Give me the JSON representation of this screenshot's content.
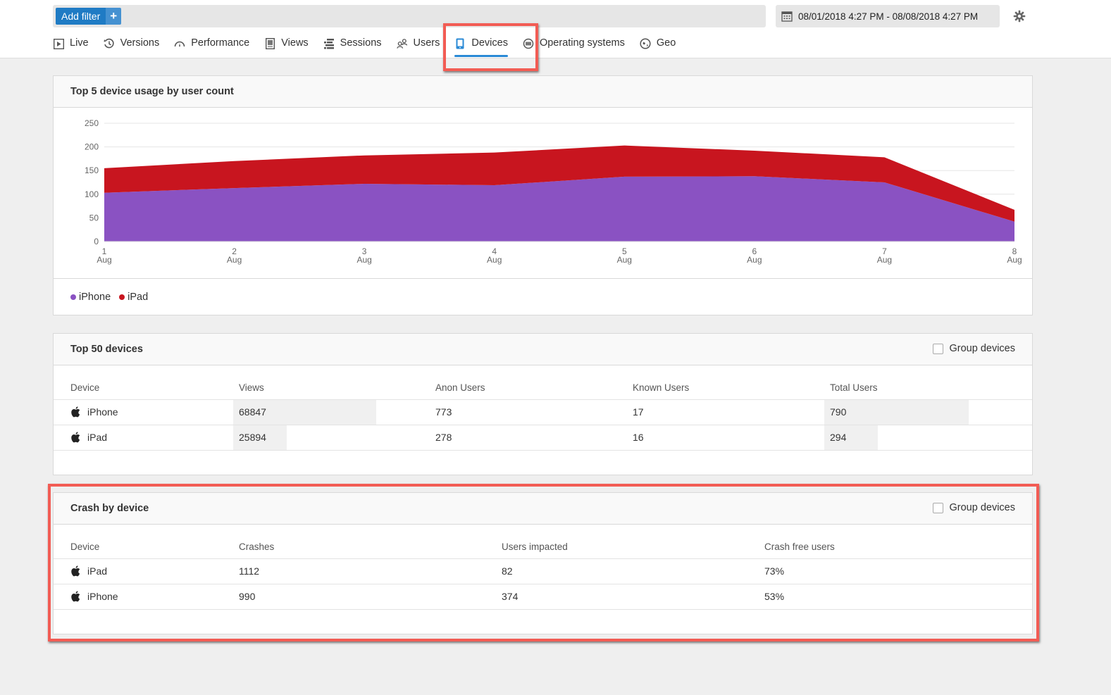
{
  "filter": {
    "add_label": "Add filter",
    "add_icon": "plus-icon"
  },
  "date_range": {
    "value": "08/01/2018 4:27 PM - 08/08/2018 4:27 PM",
    "icon": "calendar-icon"
  },
  "settings_icon": "gear-icon",
  "tabs": [
    {
      "label": "Live",
      "icon": "play-icon"
    },
    {
      "label": "Versions",
      "icon": "history-icon"
    },
    {
      "label": "Performance",
      "icon": "gauge-icon"
    },
    {
      "label": "Views",
      "icon": "document-icon"
    },
    {
      "label": "Sessions",
      "icon": "sessions-icon"
    },
    {
      "label": "Users",
      "icon": "users-icon"
    },
    {
      "label": "Devices",
      "icon": "mobile-device-icon",
      "active": true
    },
    {
      "label": "Operating systems",
      "icon": "os-icon"
    },
    {
      "label": "Geo",
      "icon": "globe-icon"
    }
  ],
  "usage_panel": {
    "title": "Top 5 device usage by user count"
  },
  "chart_data": {
    "type": "area",
    "stacked": true,
    "title": "Top 5 device usage by user count",
    "xlabel": "",
    "ylabel": "",
    "x": [
      "1\nAug",
      "2\nAug",
      "3\nAug",
      "4\nAug",
      "5\nAug",
      "6\nAug",
      "7\nAug",
      "8\nAug"
    ],
    "x_ticks": [
      {
        "day": "1",
        "month": "Aug"
      },
      {
        "day": "2",
        "month": "Aug"
      },
      {
        "day": "3",
        "month": "Aug"
      },
      {
        "day": "4",
        "month": "Aug"
      },
      {
        "day": "5",
        "month": "Aug"
      },
      {
        "day": "6",
        "month": "Aug"
      },
      {
        "day": "7",
        "month": "Aug"
      },
      {
        "day": "8",
        "month": "Aug"
      }
    ],
    "series": [
      {
        "name": "iPhone",
        "color": "#8a52c2",
        "values": [
          103,
          113,
          122,
          119,
          137,
          138,
          125,
          42
        ]
      },
      {
        "name": "iPad",
        "color": "#c8151f",
        "values": [
          52,
          57,
          60,
          69,
          66,
          54,
          53,
          25
        ]
      }
    ],
    "ylim": [
      0,
      250
    ],
    "y_ticks": [
      0,
      50,
      100,
      150,
      200,
      250
    ],
    "grid": true,
    "legend": "bottom-left"
  },
  "top_devices": {
    "title": "Top 50 devices",
    "group_label": "Group devices",
    "group_checked": false,
    "columns": [
      "Device",
      "Views",
      "Anon Users",
      "Known Users",
      "Total Users"
    ],
    "rows": [
      {
        "device": "iPhone",
        "icon": "apple-icon",
        "views": "68847",
        "views_share": 1.0,
        "anon": "773",
        "known": "17",
        "total": "790",
        "total_share": 1.0
      },
      {
        "device": "iPad",
        "icon": "apple-icon",
        "views": "25894",
        "views_share": 0.376,
        "anon": "278",
        "known": "16",
        "total": "294",
        "total_share": 0.372
      }
    ]
  },
  "crash_devices": {
    "title": "Crash by device",
    "group_label": "Group devices",
    "group_checked": false,
    "columns": [
      "Device",
      "Crashes",
      "Users impacted",
      "Crash free users"
    ],
    "rows": [
      {
        "device": "iPad",
        "icon": "apple-icon",
        "crashes": "1112",
        "impacted": "82",
        "crash_free": "73%"
      },
      {
        "device": "iPhone",
        "icon": "apple-icon",
        "crashes": "990",
        "impacted": "374",
        "crash_free": "53%"
      }
    ]
  }
}
